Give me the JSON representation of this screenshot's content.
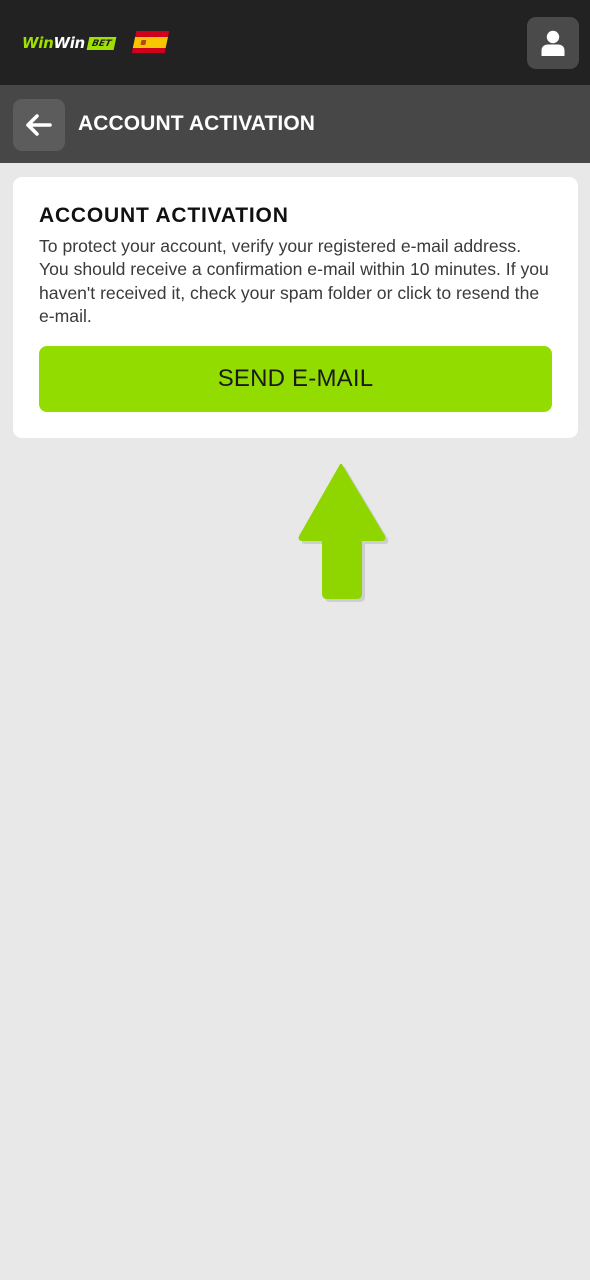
{
  "header": {
    "logo": {
      "part1": "Win",
      "part2": "Win",
      "badge": "BET",
      "icon": "winwinbet-logo"
    },
    "flag_icon": "spain-flag-icon",
    "user_icon": "user-icon"
  },
  "subheader": {
    "back_icon": "arrow-left-icon",
    "title": "ACCOUNT ACTIVATION"
  },
  "card": {
    "title": "ACCOUNT ACTIVATION",
    "description": "To protect your account, verify your registered e-mail address. You should receive a confirmation e-mail within 10 minutes. If you haven't received it, check your spam folder or click to resend the e-mail.",
    "button_label": "SEND E-MAIL"
  },
  "colors": {
    "accent": "#92dc00",
    "topbar": "#222222",
    "subbar": "#474747",
    "background": "#e8e8e8"
  },
  "annotation_icon": "up-arrow-pointer-icon"
}
